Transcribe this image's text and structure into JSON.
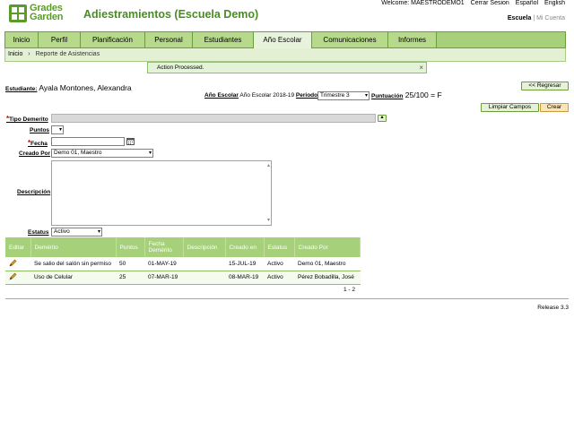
{
  "brand": {
    "logo_line1": "Grades",
    "logo_line2": "Garden",
    "app_title": "Adiestramientos (Escuela Demo)"
  },
  "top_links": {
    "welcome": "Welcome: MAESTRODEMO1",
    "logout": "Cerrar Sesion",
    "spanish": "Español",
    "english": "English"
  },
  "school_switch": {
    "active": "Escuela",
    "separator": "|",
    "inactive": "Mi Cuenta"
  },
  "nav": {
    "tabs": [
      {
        "label": "Inicio"
      },
      {
        "label": "Perfil"
      },
      {
        "label": "Planificación"
      },
      {
        "label": "Personal"
      },
      {
        "label": "Estudiantes"
      },
      {
        "label": "Año Escolar"
      },
      {
        "label": "Comunicaciones"
      },
      {
        "label": "Informes"
      }
    ]
  },
  "breadcrumb": {
    "home": "Inicio",
    "sep": "›",
    "current": "Reporte de Asistencias"
  },
  "flash": {
    "message": "Action Processed.",
    "close": "×"
  },
  "student": {
    "label": "Estudiante:",
    "name": "Ayala Montones, Alexandra"
  },
  "back_button": "<< Regresar",
  "year_row": {
    "year_label": "Año Escolar",
    "year_value": "Año Escolar 2018-19",
    "period_label": "Periodo",
    "period_value": "Trimestre 3",
    "score_label": "Puntuación",
    "score_value": "25/100 = F"
  },
  "actions": {
    "clear": "Limpiar Campos",
    "create": "Crear"
  },
  "form": {
    "tipo_label": "Tipo Demerito",
    "puntos_label": "Puntos",
    "fecha_label": "Fecha",
    "creado_label": "Creado Por",
    "creado_value": "Demo 01, Maestro",
    "descripcion_label": "Descripción",
    "estatus_label": "Estatus",
    "estatus_value": "Activo",
    "required_mark": "*"
  },
  "table": {
    "headers": [
      "Editar",
      "Demérito",
      "Puntos",
      "Fecha Demérito",
      "Descripción",
      "Creado en",
      "Estatus",
      "Creado Por"
    ],
    "rows": [
      {
        "demerito": "Se salio del salón sin permiso",
        "puntos": "50",
        "fecha": "01-MAY-19",
        "descripcion": "",
        "creado_en": "15-JUL-19",
        "estatus": "Activo",
        "creado_por": "Demo 01, Maestro"
      },
      {
        "demerito": "Uso de Celular",
        "puntos": "25",
        "fecha": "07-MAR-19",
        "descripcion": "",
        "creado_en": "08-MAR-19",
        "estatus": "Activo",
        "creado_por": "Pérez Bobadilla, José"
      }
    ],
    "pager": "1 - 2"
  },
  "release": "Release 3.3",
  "colors": {
    "brand_green": "#4a8c24",
    "tab_green": "#a7d07a",
    "create_orange": "#fbe5b8"
  }
}
